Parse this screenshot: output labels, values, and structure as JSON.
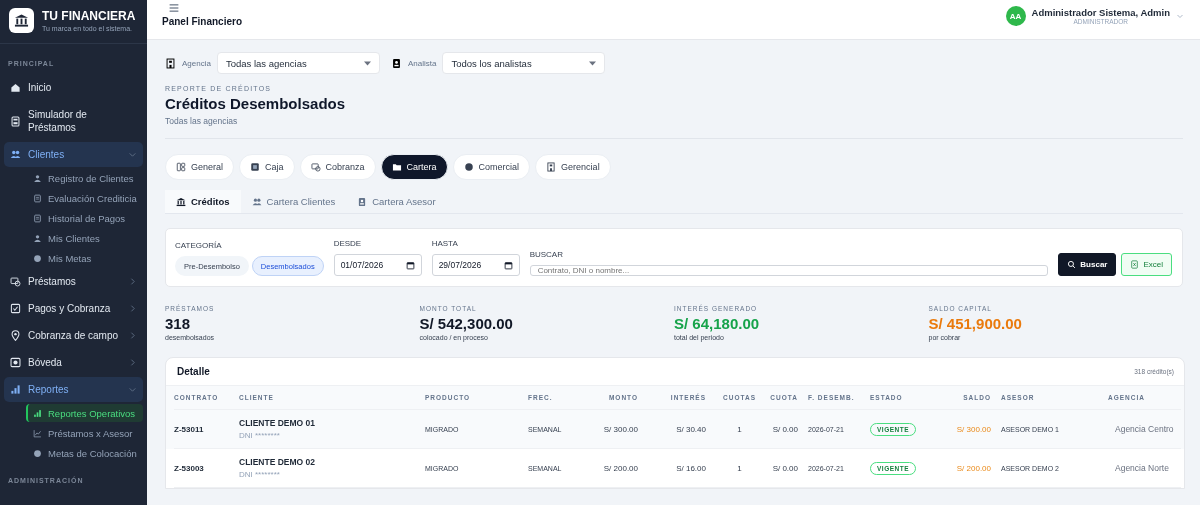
{
  "sidebar": {
    "brand": {
      "title": "TU FINANCIERA",
      "tagline": "Tu marca en todo el sistema."
    },
    "sections": [
      {
        "label": "PRINCIPAL",
        "items": [
          {
            "label": "Inicio",
            "selected": false
          },
          {
            "label": "Simulador de Préstamos",
            "selected": false
          },
          {
            "label": "Clientes",
            "selected": false,
            "expanded": true,
            "children": [
              {
                "label": "Registro de Clientes",
                "selected": false
              },
              {
                "label": "Evaluación Crediticia",
                "selected": false
              },
              {
                "label": "Historial de Pagos",
                "selected": false
              },
              {
                "label": "Mis Clientes",
                "selected": false
              },
              {
                "label": "Mis Metas",
                "selected": false
              }
            ]
          },
          {
            "label": "Préstamos",
            "selected": false,
            "expanded": false
          },
          {
            "label": "Pagos y Cobranza",
            "selected": false,
            "expanded": false
          },
          {
            "label": "Cobranza de campo",
            "selected": false,
            "expanded": false
          },
          {
            "label": "Bóveda",
            "selected": false,
            "expanded": false
          },
          {
            "label": "Reportes",
            "selected": false,
            "expanded": true,
            "children": [
              {
                "label": "Reportes Operativos",
                "selected": true
              },
              {
                "label": "Préstamos x Asesor",
                "selected": false
              },
              {
                "label": "Metas de Colocación",
                "selected": false
              }
            ]
          }
        ]
      },
      {
        "label": "ADMINISTRACIÓN"
      }
    ]
  },
  "header": {
    "title": "Panel Financiero",
    "user": {
      "initials": "AA",
      "name": "Administrador Sistema, Admin",
      "role": "ADMINISTRADOR"
    }
  },
  "filters": [
    {
      "label": "Agencia",
      "value": "Todas las agencias"
    },
    {
      "label": "Analista",
      "value": "Todos los analistas"
    }
  ],
  "report": {
    "eyebrow": "REPORTE DE CRÉDITOS",
    "title": "Créditos Desembolsados",
    "subtitle": "Todas las agencias"
  },
  "category_tabs": [
    {
      "label": "General",
      "selected": false
    },
    {
      "label": "Caja",
      "selected": false
    },
    {
      "label": "Cobranza",
      "selected": false
    },
    {
      "label": "Cartera",
      "selected": true
    },
    {
      "label": "Comercial",
      "selected": false
    },
    {
      "label": "Gerencial",
      "selected": false
    }
  ],
  "sub_tabs": [
    {
      "label": "Créditos",
      "selected": true
    },
    {
      "label": "Cartera Clientes",
      "selected": false
    },
    {
      "label": "Cartera Asesor",
      "selected": false
    }
  ],
  "search_panel": {
    "category_label": "CATEGORÍA",
    "categories": [
      {
        "label": "Pre-Desembolso",
        "selected": false
      },
      {
        "label": "Desembolsados",
        "selected": true
      }
    ],
    "from_label": "DESDE",
    "from_value": "01/07/2026",
    "to_label": "HASTA",
    "to_value": "29/07/2026",
    "search_label": "BUSCAR",
    "search_placeholder": "Contrato, DNI o nombre...",
    "search_button": "Buscar",
    "excel_button": "Excel"
  },
  "stats": [
    {
      "label": "PRÉSTAMOS",
      "value": "318",
      "note": "desembolsados",
      "color": "#111827"
    },
    {
      "label": "MONTO TOTAL",
      "value": "S/ 542,300.00",
      "note": "colocado / en proceso",
      "color": "#111827"
    },
    {
      "label": "INTERÉS GENERADO",
      "value": "S/ 64,180.00",
      "note": "total del periodo",
      "color": "#16a34a"
    },
    {
      "label": "SALDO CAPITAL",
      "value": "S/ 451,900.00",
      "note": "por cobrar",
      "color": "#ea7a0c"
    }
  ],
  "table": {
    "title": "Detalle",
    "count": "318 crédito(s)",
    "columns": [
      "CONTRATO",
      "CLIENTE",
      "PRODUCTO",
      "FREC.",
      "MONTO",
      "INTERÉS",
      "CUOTAS",
      "CUOTA",
      "F. DESEMB.",
      "ESTADO",
      "SALDO",
      "ASESOR",
      "AGENCIA"
    ],
    "rows": [
      {
        "contrato": "Z-53011",
        "cliente": "CLIENTE DEMO 01",
        "dni": "DNI ********",
        "producto": "MIGRADO",
        "frec": "SEMANAL",
        "monto": "S/ 300.00",
        "interes": "S/ 30.40",
        "cuotas": "1",
        "cuota": "S/ 0.00",
        "fecha": "2026-07-21",
        "estado": "VIGENTE",
        "saldo": "S/ 300.00",
        "asesor": "ASESOR DEMO 1",
        "agencia": "Agencia Centro"
      },
      {
        "contrato": "Z-53003",
        "cliente": "CLIENTE DEMO 02",
        "dni": "DNI ********",
        "producto": "MIGRADO",
        "frec": "SEMANAL",
        "monto": "S/ 200.00",
        "interes": "S/ 16.00",
        "cuotas": "1",
        "cuota": "S/ 0.00",
        "fecha": "2026-07-21",
        "estado": "VIGENTE",
        "saldo": "S/ 200.00",
        "asesor": "ASESOR DEMO 2",
        "agencia": "Agencia Norte"
      }
    ]
  }
}
